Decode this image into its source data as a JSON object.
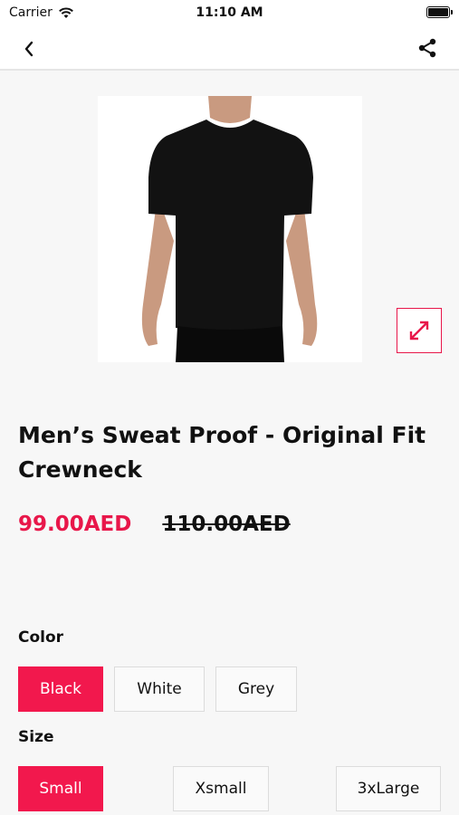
{
  "status": {
    "carrier": "Carrier",
    "time": "11:10 AM"
  },
  "nav": {
    "back_icon": "chevron-left-icon",
    "share_icon": "share-icon"
  },
  "product": {
    "title": "Men’s Sweat Proof - Original Fit Crewneck",
    "price": "99.00AED",
    "old_price": "110.00AED",
    "image": "black-crewneck-tshirt-photo"
  },
  "color": {
    "label": "Color",
    "options": [
      "Black",
      "White",
      "Grey"
    ],
    "selected": "Black"
  },
  "size": {
    "label": "Size",
    "options": [
      "Small",
      "Xsmall",
      "3xLarge"
    ],
    "selected": "Small"
  },
  "theme": {
    "accent": "#e8174a"
  }
}
